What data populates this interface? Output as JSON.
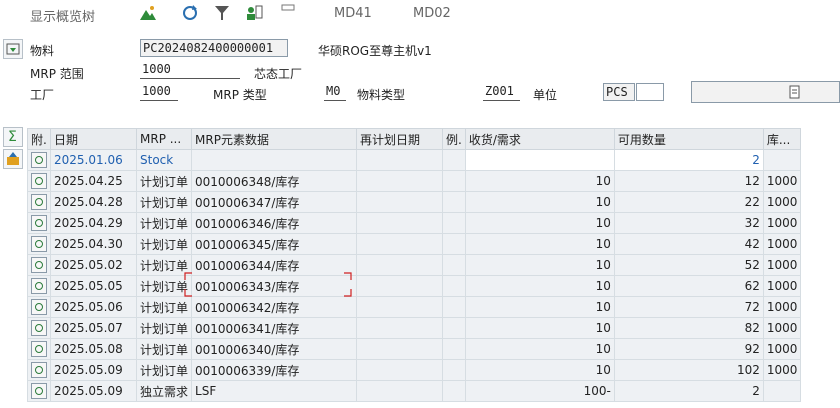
{
  "toolbar": {
    "overview_label": "显示概览树",
    "md41_label": "MD41",
    "md02_label": "MD02"
  },
  "header": {
    "material_label": "物料",
    "material_value": "PC2024082400000001",
    "material_desc": "华硕ROG至尊主机v1",
    "mrp_area_label": "MRP 范围",
    "mrp_area_value": "1000",
    "mrp_area_desc": "芯态工厂",
    "plant_label": "工厂",
    "plant_value": "1000",
    "mrp_type_label": "MRP 类型",
    "mrp_type_value": "M0",
    "material_type_label": "物料类型",
    "material_type_value": "Z001",
    "unit_label": "单位",
    "unit_value": "PCS"
  },
  "grid": {
    "headers": [
      "附.",
      "日期",
      "MRP ...",
      "MRP元素数据",
      "再计划日期",
      "例.",
      "收货/需求",
      "可用数量",
      "库..."
    ],
    "rows": [
      {
        "date": "2025.01.06",
        "elem": "Stock",
        "data": "",
        "qty": "",
        "avail": "2",
        "stor": ""
      },
      {
        "date": "2025.04.25",
        "elem": "计划订单",
        "data": "0010006348/库存",
        "qty": "10",
        "avail": "12",
        "stor": "1000"
      },
      {
        "date": "2025.04.28",
        "elem": "计划订单",
        "data": "0010006347/库存",
        "qty": "10",
        "avail": "22",
        "stor": "1000"
      },
      {
        "date": "2025.04.29",
        "elem": "计划订单",
        "data": "0010006346/库存",
        "qty": "10",
        "avail": "32",
        "stor": "1000"
      },
      {
        "date": "2025.04.30",
        "elem": "计划订单",
        "data": "0010006345/库存",
        "qty": "10",
        "avail": "42",
        "stor": "1000"
      },
      {
        "date": "2025.05.02",
        "elem": "计划订单",
        "data": "0010006344/库存",
        "qty": "10",
        "avail": "52",
        "stor": "1000"
      },
      {
        "date": "2025.05.05",
        "elem": "计划订单",
        "data": "0010006343/库存",
        "qty": "10",
        "avail": "62",
        "stor": "1000"
      },
      {
        "date": "2025.05.06",
        "elem": "计划订单",
        "data": "0010006342/库存",
        "qty": "10",
        "avail": "72",
        "stor": "1000"
      },
      {
        "date": "2025.05.07",
        "elem": "计划订单",
        "data": "0010006341/库存",
        "qty": "10",
        "avail": "82",
        "stor": "1000"
      },
      {
        "date": "2025.05.08",
        "elem": "计划订单",
        "data": "0010006340/库存",
        "qty": "10",
        "avail": "92",
        "stor": "1000"
      },
      {
        "date": "2025.05.09",
        "elem": "计划订单",
        "data": "0010006339/库存",
        "qty": "10",
        "avail": "102",
        "stor": "1000"
      },
      {
        "date": "2025.05.09",
        "elem": "独立需求",
        "data": "LSF",
        "qty": "100-",
        "avail": "2",
        "stor": ""
      }
    ]
  }
}
